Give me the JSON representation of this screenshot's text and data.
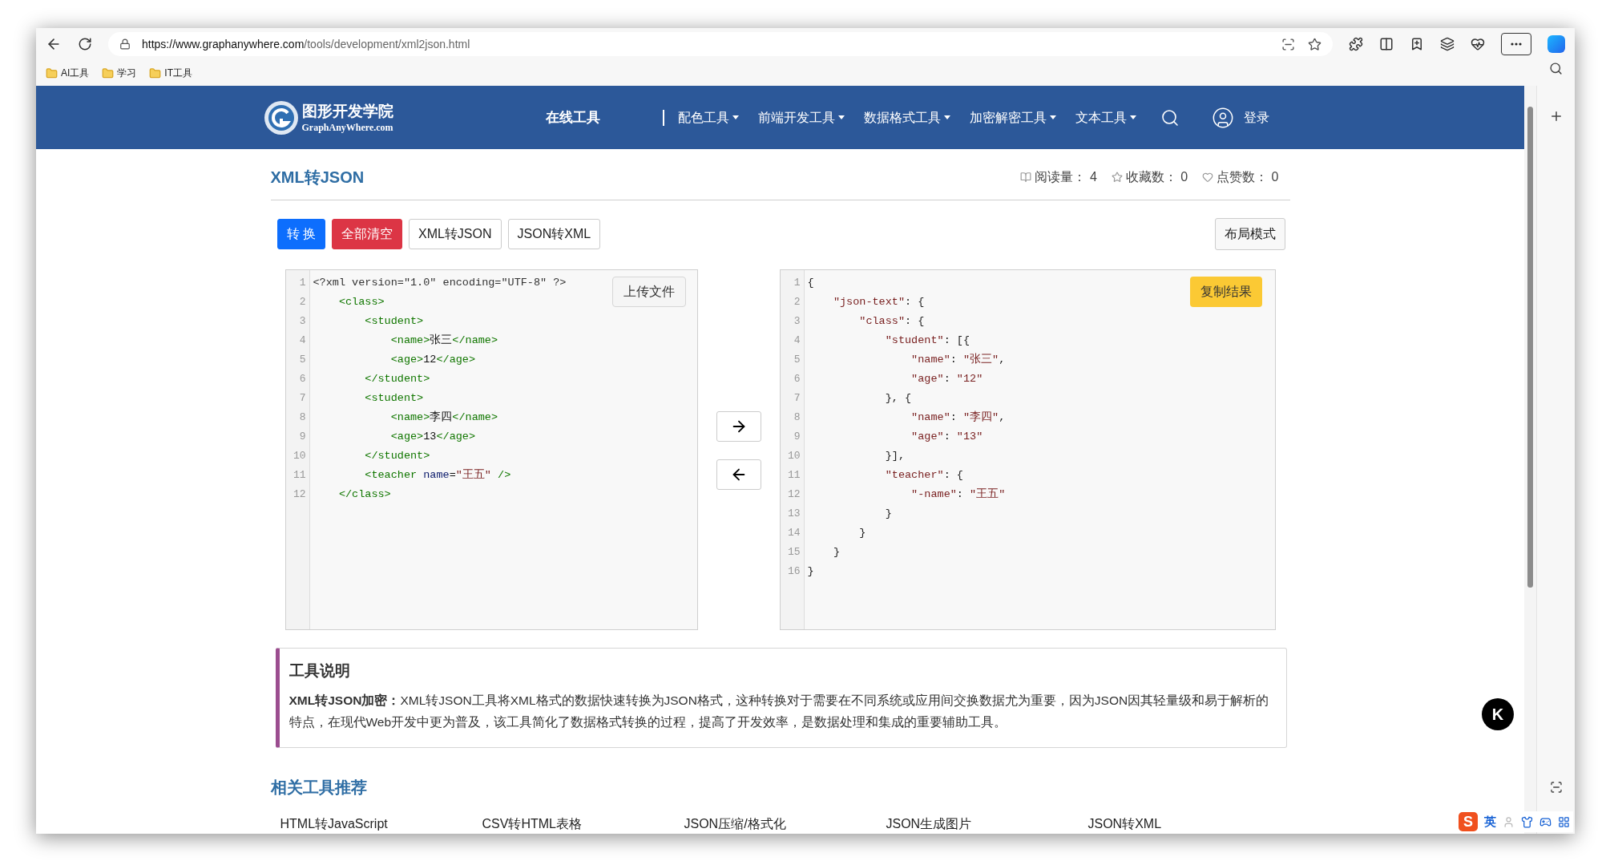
{
  "browser": {
    "url_host": "https://www.graphanywhere.com",
    "url_path": "/tools/development/xml2json.html",
    "bookmarks": [
      {
        "label": "AI工具"
      },
      {
        "label": "学习"
      },
      {
        "label": "IT工具"
      }
    ]
  },
  "header": {
    "logo_title": "图形开发学院",
    "logo_subtitle": "GraphAnyWhere.com",
    "online_tools": "在线工具",
    "nav": [
      {
        "label": "配色工具"
      },
      {
        "label": "前端开发工具"
      },
      {
        "label": "数据格式工具"
      },
      {
        "label": "加密解密工具"
      },
      {
        "label": "文本工具"
      }
    ],
    "login": "登录"
  },
  "page": {
    "title": "XML转JSON",
    "stats": [
      {
        "kind": "reads",
        "label": "阅读量：",
        "value": "4"
      },
      {
        "kind": "favorites",
        "label": "收藏数：",
        "value": "0"
      },
      {
        "kind": "likes",
        "label": "点赞数：",
        "value": "0"
      }
    ],
    "buttons": [
      {
        "kind": "primary",
        "label": "转 换"
      },
      {
        "kind": "danger",
        "label": "全部清空"
      },
      {
        "kind": "outline",
        "label": "XML转JSON"
      },
      {
        "kind": "outline",
        "label": "JSON转XML"
      }
    ],
    "layout_button": "布局模式"
  },
  "input_editor": {
    "upload_button": "上传文件",
    "lines": [
      {
        "number": "1",
        "segments": [
          {
            "kind": "meta",
            "text": "<?xml version=\"1.0\" encoding=\"UTF-8\" ?>"
          }
        ]
      },
      {
        "number": "2",
        "segments": [
          {
            "kind": "tag",
            "text": "    <class>"
          }
        ]
      },
      {
        "number": "3",
        "segments": [
          {
            "kind": "tag",
            "text": "        <student>"
          }
        ]
      },
      {
        "number": "4",
        "segments": [
          {
            "kind": "tag",
            "text": "            <name>"
          },
          {
            "kind": "text",
            "text": "张三"
          },
          {
            "kind": "tag",
            "text": "</name>"
          }
        ]
      },
      {
        "number": "5",
        "segments": [
          {
            "kind": "tag",
            "text": "            <age>"
          },
          {
            "kind": "text",
            "text": "12"
          },
          {
            "kind": "tag",
            "text": "</age>"
          }
        ]
      },
      {
        "number": "6",
        "segments": [
          {
            "kind": "tag",
            "text": "        </student>"
          }
        ]
      },
      {
        "number": "7",
        "segments": [
          {
            "kind": "tag",
            "text": "        <student>"
          }
        ]
      },
      {
        "number": "8",
        "segments": [
          {
            "kind": "tag",
            "text": "            <name>"
          },
          {
            "kind": "text",
            "text": "李四"
          },
          {
            "kind": "tag",
            "text": "</name>"
          }
        ]
      },
      {
        "number": "9",
        "segments": [
          {
            "kind": "tag",
            "text": "            <age>"
          },
          {
            "kind": "text",
            "text": "13"
          },
          {
            "kind": "tag",
            "text": "</age>"
          }
        ]
      },
      {
        "number": "10",
        "segments": [
          {
            "kind": "tag",
            "text": "        </student>"
          }
        ]
      },
      {
        "number": "11",
        "segments": [
          {
            "kind": "tag",
            "text": "        <teacher "
          },
          {
            "kind": "attr",
            "text": "name"
          },
          {
            "kind": "text",
            "text": "="
          },
          {
            "kind": "string",
            "text": "\"王五\""
          },
          {
            "kind": "tag",
            "text": " />"
          }
        ]
      },
      {
        "number": "12",
        "segments": [
          {
            "kind": "tag",
            "text": "    </class>"
          }
        ]
      }
    ]
  },
  "arrows": [
    {
      "kind": "right"
    },
    {
      "kind": "left"
    }
  ],
  "output_editor": {
    "copy_button": "复制结果",
    "lines": [
      {
        "number": "1",
        "segments": [
          {
            "kind": "punct",
            "text": "{"
          }
        ]
      },
      {
        "number": "2",
        "segments": [
          {
            "kind": "string",
            "text": "    \"json-text\""
          },
          {
            "kind": "punct",
            "text": ": {"
          }
        ]
      },
      {
        "number": "3",
        "segments": [
          {
            "kind": "string",
            "text": "        \"class\""
          },
          {
            "kind": "punct",
            "text": ": {"
          }
        ]
      },
      {
        "number": "4",
        "segments": [
          {
            "kind": "string",
            "text": "            \"student\""
          },
          {
            "kind": "punct",
            "text": ": [{"
          }
        ]
      },
      {
        "number": "5",
        "segments": [
          {
            "kind": "string",
            "text": "                \"name\""
          },
          {
            "kind": "punct",
            "text": ": "
          },
          {
            "kind": "string",
            "text": "\"张三\""
          },
          {
            "kind": "punct",
            "text": ","
          }
        ]
      },
      {
        "number": "6",
        "segments": [
          {
            "kind": "string",
            "text": "                \"age\""
          },
          {
            "kind": "punct",
            "text": ": "
          },
          {
            "kind": "string",
            "text": "\"12\""
          }
        ]
      },
      {
        "number": "7",
        "segments": [
          {
            "kind": "punct",
            "text": "            }, {"
          }
        ]
      },
      {
        "number": "8",
        "segments": [
          {
            "kind": "string",
            "text": "                \"name\""
          },
          {
            "kind": "punct",
            "text": ": "
          },
          {
            "kind": "string",
            "text": "\"李四\""
          },
          {
            "kind": "punct",
            "text": ","
          }
        ]
      },
      {
        "number": "9",
        "segments": [
          {
            "kind": "string",
            "text": "                \"age\""
          },
          {
            "kind": "punct",
            "text": ": "
          },
          {
            "kind": "string",
            "text": "\"13\""
          }
        ]
      },
      {
        "number": "10",
        "segments": [
          {
            "kind": "punct",
            "text": "            }],"
          }
        ]
      },
      {
        "number": "11",
        "segments": [
          {
            "kind": "string",
            "text": "            \"teacher\""
          },
          {
            "kind": "punct",
            "text": ": {"
          }
        ]
      },
      {
        "number": "12",
        "segments": [
          {
            "kind": "string",
            "text": "                \"-name\""
          },
          {
            "kind": "punct",
            "text": ": "
          },
          {
            "kind": "string",
            "text": "\"王五\""
          }
        ]
      },
      {
        "number": "13",
        "segments": [
          {
            "kind": "punct",
            "text": "            }"
          }
        ]
      },
      {
        "number": "14",
        "segments": [
          {
            "kind": "punct",
            "text": "        }"
          }
        ]
      },
      {
        "number": "15",
        "segments": [
          {
            "kind": "punct",
            "text": "    }"
          }
        ]
      },
      {
        "number": "16",
        "segments": [
          {
            "kind": "punct",
            "text": "}"
          }
        ]
      }
    ]
  },
  "description": {
    "title": "工具说明",
    "text": "**XML转JSON加密：**XML转JSON工具将XML格式的数据快速转换为JSON格式，这种转换对于需要在不同系统或应用间交换数据尤为重要，因为JSON因其轻量级和易于解析的特点，在现代Web开发中更为普及，该工具简化了数据格式转换的过程，提高了开发效率，是数据处理和集成的重要辅助工具。"
  },
  "related": {
    "title": "相关工具推荐",
    "tools": [
      "HTML转JavaScript",
      "CSV转HTML表格",
      "JSON压缩/格式化",
      "JSON生成图片",
      "JSON转XML"
    ]
  },
  "floating_badge": {
    "letter": "K"
  },
  "ime_bar": {
    "logo": "S",
    "mode": "英"
  }
}
